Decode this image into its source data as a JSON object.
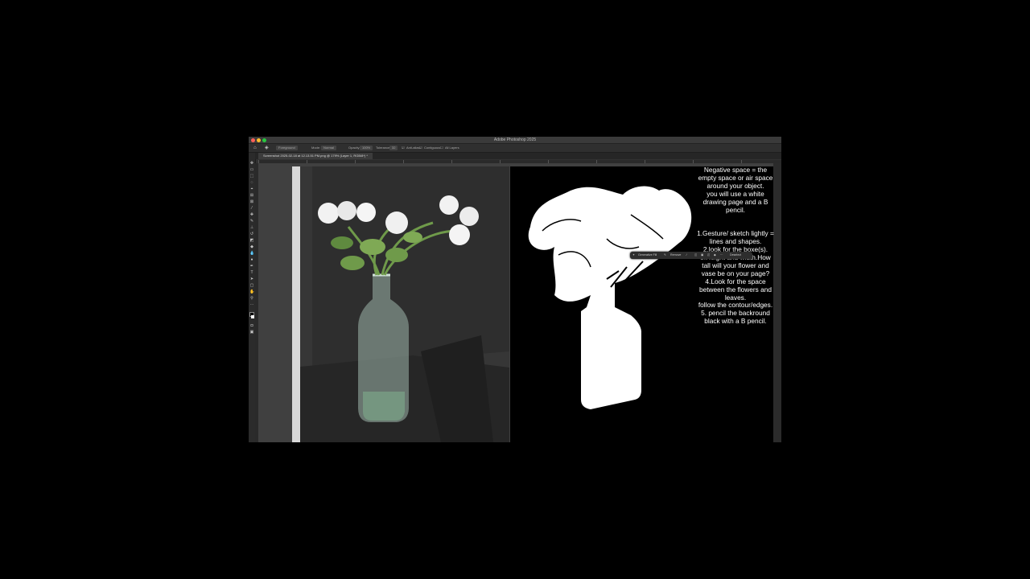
{
  "app": {
    "title": "Adobe Photoshop 2025",
    "window_controls": {
      "close_color": "#ff5f57",
      "minimize_color": "#febc2e",
      "zoom_color": "#28c840"
    }
  },
  "options_bar": {
    "home_icon": "home-icon",
    "tool_icon": "paint-bucket-icon",
    "fill_source": "Foreground",
    "mode_label": "Mode:",
    "mode_value": "Normal",
    "opacity_label": "Opacity:",
    "opacity_value": "100%",
    "tolerance_label": "Tolerance:",
    "tolerance_value": "32",
    "anti_alias_label": "Anti-alias",
    "contiguous_label": "Contiguous",
    "all_layers_label": "All Layers"
  },
  "document": {
    "tab_title": "Screenshot 2025-02-18 at 12.13.51 PM.png @ 179% (Layer 1, RGB/8*) *"
  },
  "instructions": {
    "text": "Negative space = the empty space or air space around your object.\nyou will use a white drawing page and a B pencil.\n\n\n1.Gesture/ sketch lightly = lines and shapes.\n2.look for the boxe(s).\n3.Height and width.How tall will your flower and vase be on your page?\n4.Look for the space between the flowers and leaves.\nfollow the contour/edges.\n5. pencil the backround black with a B pencil."
  },
  "contextual_task_bar": {
    "generative_fill_label": "Generative Fill",
    "remove_label": "Remove",
    "deselect_label": "Deselect"
  },
  "colors": {
    "ui_dark": "#323232",
    "panel": "#2b2b2b",
    "negative_space_background": "#000000",
    "silhouette": "#ffffff",
    "leaf_green": "#6f9a4a"
  }
}
